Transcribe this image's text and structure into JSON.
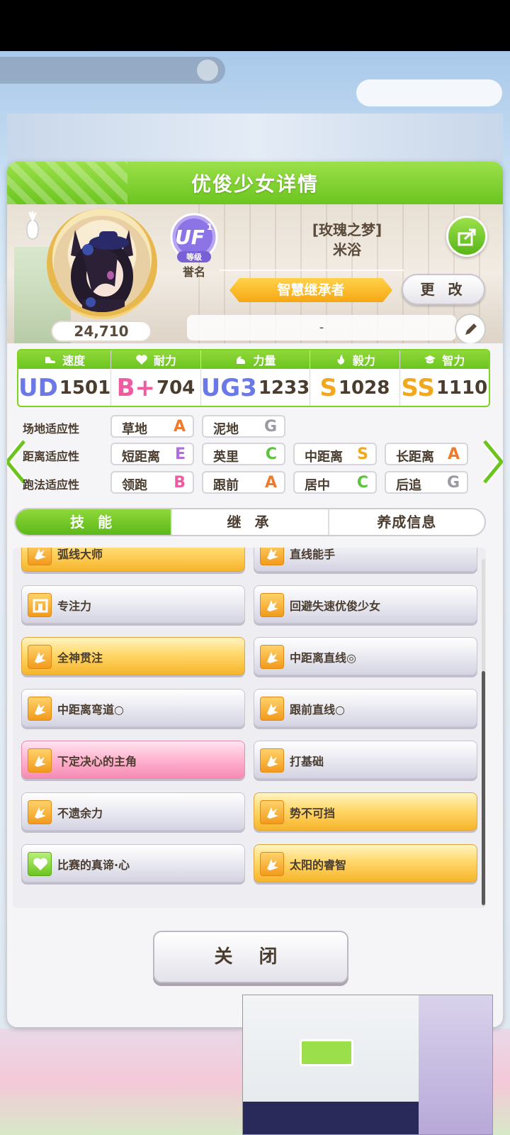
{
  "panel": {
    "title": "优俊少女详情"
  },
  "profile": {
    "fans": "24,710",
    "rank_badge": "UF",
    "rank_sub": "1",
    "rank_level_label": "等级",
    "rank_caption": "誉名",
    "nickname": "[玫瑰之梦]",
    "name": "米浴",
    "title_banner": "智慧继承者",
    "change_label": "更 改",
    "comment": "-"
  },
  "stats": [
    {
      "label": "速度",
      "icon": "shoe-icon",
      "grade": "UD",
      "value": "1501",
      "grade_color": "#6a78e8"
    },
    {
      "label": "耐力",
      "icon": "heart-icon",
      "grade": "B+",
      "value": "704",
      "grade_color": "#ef5aa0"
    },
    {
      "label": "力量",
      "icon": "muscle-icon",
      "grade": "UG3",
      "value": "1233",
      "grade_color": "#6a78e8"
    },
    {
      "label": "毅力",
      "icon": "flame-icon",
      "grade": "S",
      "value": "1028",
      "grade_color": "#f2a81d"
    },
    {
      "label": "智力",
      "icon": "graduation-cap-icon",
      "grade": "SS",
      "value": "1110",
      "grade_color": "#f2a81d"
    }
  ],
  "aptitude": {
    "field": {
      "label": "场地适应性",
      "items": [
        {
          "name": "草地",
          "grade": "A"
        },
        {
          "name": "泥地",
          "grade": "G"
        }
      ]
    },
    "distance": {
      "label": "距离适应性",
      "items": [
        {
          "name": "短距离",
          "grade": "E"
        },
        {
          "name": "英里",
          "grade": "C"
        },
        {
          "name": "中距离",
          "grade": "S"
        },
        {
          "name": "长距离",
          "grade": "A"
        }
      ]
    },
    "style": {
      "label": "跑法适应性",
      "items": [
        {
          "name": "领跑",
          "grade": "B"
        },
        {
          "name": "跟前",
          "grade": "A"
        },
        {
          "name": "居中",
          "grade": "C"
        },
        {
          "name": "后追",
          "grade": "G"
        }
      ]
    }
  },
  "grade_colors": {
    "S": "#f2a81d",
    "A": "#f07a2a",
    "B": "#ef5aa0",
    "C": "#5bc43a",
    "E": "#b46be0",
    "G": "#9a9aa0"
  },
  "tabs": [
    "技 能",
    "继 承",
    "养成信息"
  ],
  "skills": [
    {
      "name": "弧线大师",
      "style": "gold",
      "icon": "skill-speed-icon"
    },
    {
      "name": "直线能手",
      "style": "white",
      "icon": "skill-speed-icon"
    },
    {
      "name": "专注力",
      "style": "white",
      "icon": "skill-gate-icon"
    },
    {
      "name": "回避失速优俊少女",
      "style": "white",
      "icon": "skill-speed-icon"
    },
    {
      "name": "全神贯注",
      "style": "gold",
      "icon": "skill-speed-icon"
    },
    {
      "name": "中距离直线◎",
      "style": "white",
      "icon": "skill-speed-icon"
    },
    {
      "name": "中距离弯道○",
      "style": "white",
      "icon": "skill-speed-icon"
    },
    {
      "name": "跟前直线○",
      "style": "white",
      "icon": "skill-speed-icon"
    },
    {
      "name": "下定决心的主角",
      "style": "pink",
      "icon": "skill-speed-icon"
    },
    {
      "name": "打基础",
      "style": "white",
      "icon": "skill-speed-icon"
    },
    {
      "name": "不遗余力",
      "style": "white",
      "icon": "skill-speed-icon"
    },
    {
      "name": "势不可挡",
      "style": "gold",
      "icon": "skill-speed-icon"
    },
    {
      "name": "比赛的真谛·心",
      "style": "white",
      "icon": "skill-heart-icon"
    },
    {
      "name": "太阳的睿智",
      "style": "gold",
      "icon": "skill-speed-icon"
    }
  ],
  "close_label": "关 闭"
}
